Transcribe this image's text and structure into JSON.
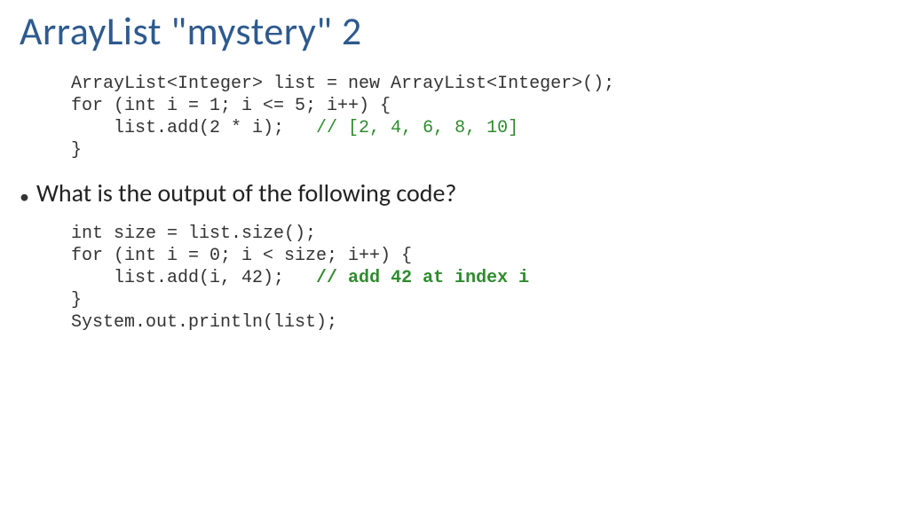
{
  "title": "ArrayList \"mystery\" 2",
  "code1": {
    "l1": "ArrayList<Integer> list = new ArrayList<Integer>();",
    "l2": "for (int i = 1; i <= 5; i++) {",
    "l3a": "    list.add(2 * i);",
    "l3b": "   // [2, 4, 6, 8, 10]",
    "l4": "}"
  },
  "bullet": "What is the output of the following code?",
  "code2": {
    "l1": "int size = list.size();",
    "l2": "for (int i = 0; i < size; i++) {",
    "l3a": "    list.add(i, 42);",
    "l3b": "   // add 42 at index i",
    "l4": "}",
    "l5": "System.out.println(list);"
  }
}
